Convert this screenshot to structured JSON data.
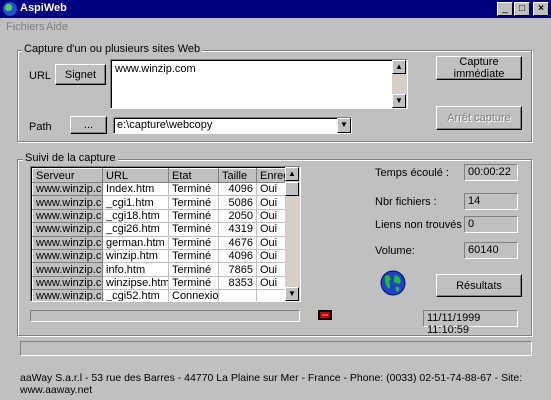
{
  "window": {
    "title": "AspiWeb",
    "minimize": "_",
    "maximize": "□",
    "close": "×"
  },
  "menu": [
    "Fichiers",
    "Aide"
  ],
  "capture_group": {
    "label": "Capture d'un ou plusieurs sites Web",
    "url_label": "URL",
    "signet_button": "Signet",
    "url_value": "www.winzip.com",
    "path_label": "Path",
    "browse_button": "...",
    "path_value": "e:\\capture\\webcopy",
    "capture_button": "Capture immédiate",
    "stop_button": "Arrêt capture"
  },
  "follow_group": {
    "label": "Suivi de la capture",
    "columns": [
      "Serveur",
      "URL",
      "Etat",
      "Taille",
      "Enregi"
    ],
    "rows": [
      [
        "www.winzip.com",
        "Index.htm",
        "Terminé",
        "4096",
        "Oui"
      ],
      [
        "www.winzip.com",
        "_cgi1.htm",
        "Terminé",
        "5086",
        "Oui"
      ],
      [
        "www.winzip.com",
        "_cgi18.htm",
        "Terminé",
        "2050",
        "Oui"
      ],
      [
        "www.winzip.com",
        "_cgi26.htm",
        "Terminé",
        "4319",
        "Oui"
      ],
      [
        "www.winzip.com",
        "german.htm",
        "Terminé",
        "4676",
        "Oui"
      ],
      [
        "www.winzip.com",
        "winzip.htm",
        "Terminé",
        "4096",
        "Oui"
      ],
      [
        "www.winzip.com",
        "info.htm",
        "Terminé",
        "7865",
        "Oui"
      ],
      [
        "www.winzip.com",
        "winzipse.htm",
        "Terminé",
        "8353",
        "Oui"
      ],
      [
        "www.winzip.com",
        "_cgi52.htm",
        "Connexion",
        "",
        ""
      ]
    ],
    "stats": [
      {
        "label": "Temps écoulé :",
        "value": "00:00:22"
      },
      {
        "label": "Nbr fichiers :",
        "value": "14"
      },
      {
        "label": "Liens non trouvés :",
        "value": "0"
      },
      {
        "label": "Volume:",
        "value": "60140"
      }
    ],
    "results_button": "Résultats",
    "datetime": "11/11/1999 11:10:59"
  },
  "footer": "aaWay S.a.r.l - 53 rue des Barres - 44770 La Plaine sur Mer - France - Phone: (0033) 02-51-74-88-67 - Site: www.aaway.net",
  "icons": {
    "app": "globe-icon",
    "globe": "globe-icon",
    "network": "network-icon"
  }
}
